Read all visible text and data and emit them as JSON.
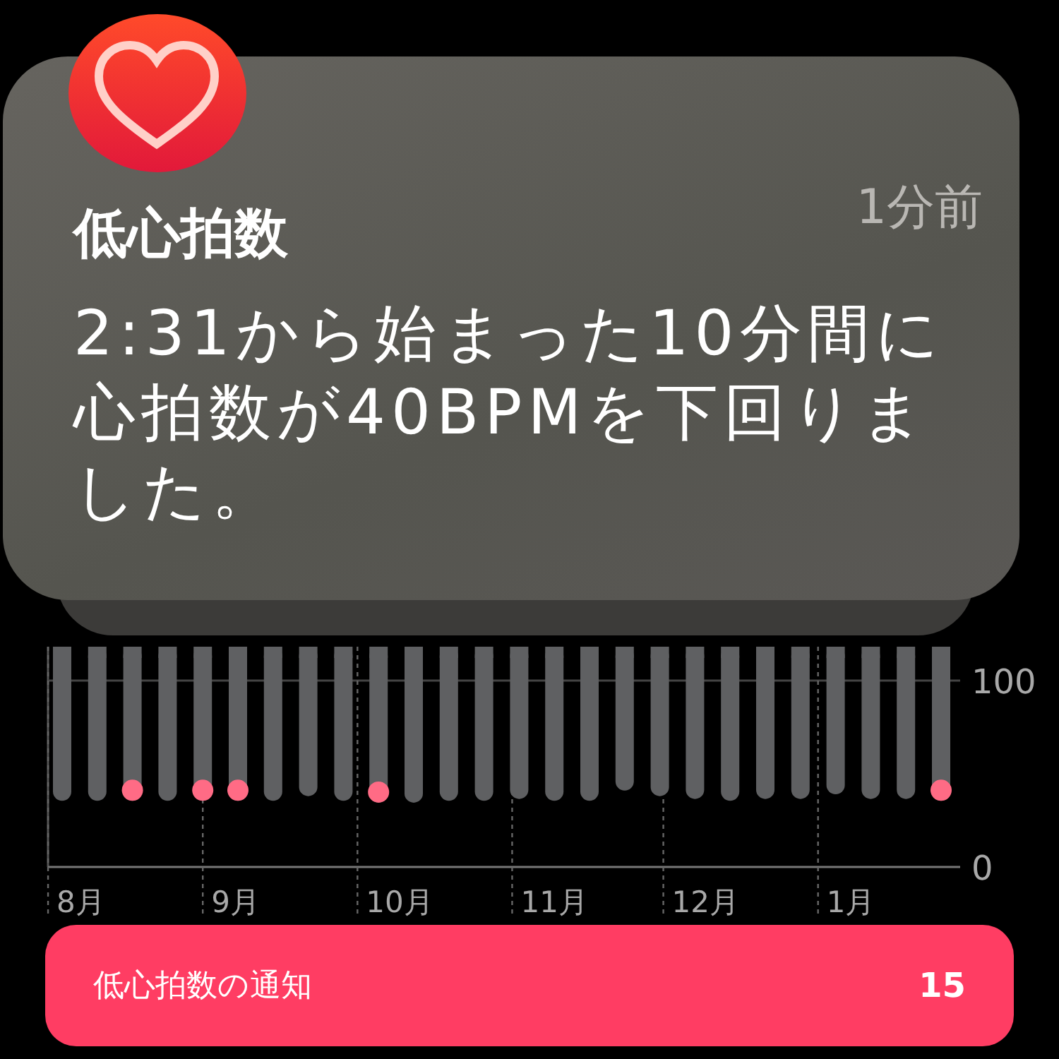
{
  "notification": {
    "time": "1分前",
    "title": "低心拍数",
    "body": "2:31から始まった10分間に心拍数が40BPMを下回りました。"
  },
  "chart": {
    "y_labels": [
      "100",
      "0"
    ],
    "month_labels": [
      "8月",
      "9月",
      "10月",
      "11月",
      "12月",
      "1月"
    ]
  },
  "button": {
    "label": "低心拍数の通知",
    "count": "15"
  }
}
